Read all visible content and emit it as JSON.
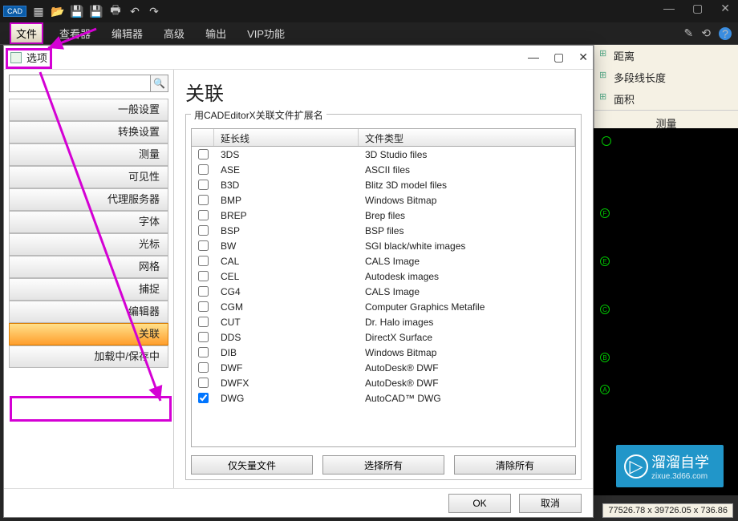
{
  "app": {
    "logo": "CAD"
  },
  "menu": {
    "items": [
      "文件",
      "查看器",
      "编辑器",
      "高级",
      "输出",
      "VIP功能"
    ],
    "active_index": 0
  },
  "right_panel": {
    "items": [
      "距离",
      "多段线长度",
      "面积"
    ],
    "title": "测量"
  },
  "dialog": {
    "title": "选项",
    "heading": "关联",
    "group_label": "用CADEditorX关联文件扩展名",
    "table": {
      "col_ext": "延长线",
      "col_type": "文件类型",
      "rows": [
        {
          "ext": "3DS",
          "type": "3D Studio files",
          "chk": false
        },
        {
          "ext": "ASE",
          "type": "ASCII files",
          "chk": false
        },
        {
          "ext": "B3D",
          "type": "Blitz 3D model files",
          "chk": false
        },
        {
          "ext": "BMP",
          "type": "Windows Bitmap",
          "chk": false
        },
        {
          "ext": "BREP",
          "type": "Brep files",
          "chk": false
        },
        {
          "ext": "BSP",
          "type": "BSP files",
          "chk": false
        },
        {
          "ext": "BW",
          "type": "SGI black/white images",
          "chk": false
        },
        {
          "ext": "CAL",
          "type": "CALS Image",
          "chk": false
        },
        {
          "ext": "CEL",
          "type": "Autodesk images",
          "chk": false
        },
        {
          "ext": "CG4",
          "type": "CALS Image",
          "chk": false
        },
        {
          "ext": "CGM",
          "type": "Computer Graphics Metafile",
          "chk": false
        },
        {
          "ext": "CUT",
          "type": "Dr. Halo images",
          "chk": false
        },
        {
          "ext": "DDS",
          "type": "DirectX Surface",
          "chk": false
        },
        {
          "ext": "DIB",
          "type": "Windows Bitmap",
          "chk": false
        },
        {
          "ext": "DWF",
          "type": "AutoDesk® DWF",
          "chk": false
        },
        {
          "ext": "DWFX",
          "type": "AutoDesk® DWF",
          "chk": false
        },
        {
          "ext": "DWG",
          "type": "AutoCAD™ DWG",
          "chk": true
        }
      ]
    },
    "btn_vector": "仅矢量文件",
    "btn_select_all": "选择所有",
    "btn_clear_all": "清除所有",
    "btn_ok": "OK",
    "btn_cancel": "取消"
  },
  "sidebar": {
    "items": [
      "一般设置",
      "转换设置",
      "测量",
      "可见性",
      "代理服务器",
      "字体",
      "光标",
      "网格",
      "捕捉",
      "编辑器",
      "关联",
      "加载中/保存中"
    ],
    "active_index": 10
  },
  "watermark": {
    "main": "溜溜自学",
    "sub": "zixue.3d66.com"
  },
  "coords": "77526.78 x 39726.05 x 736.86"
}
